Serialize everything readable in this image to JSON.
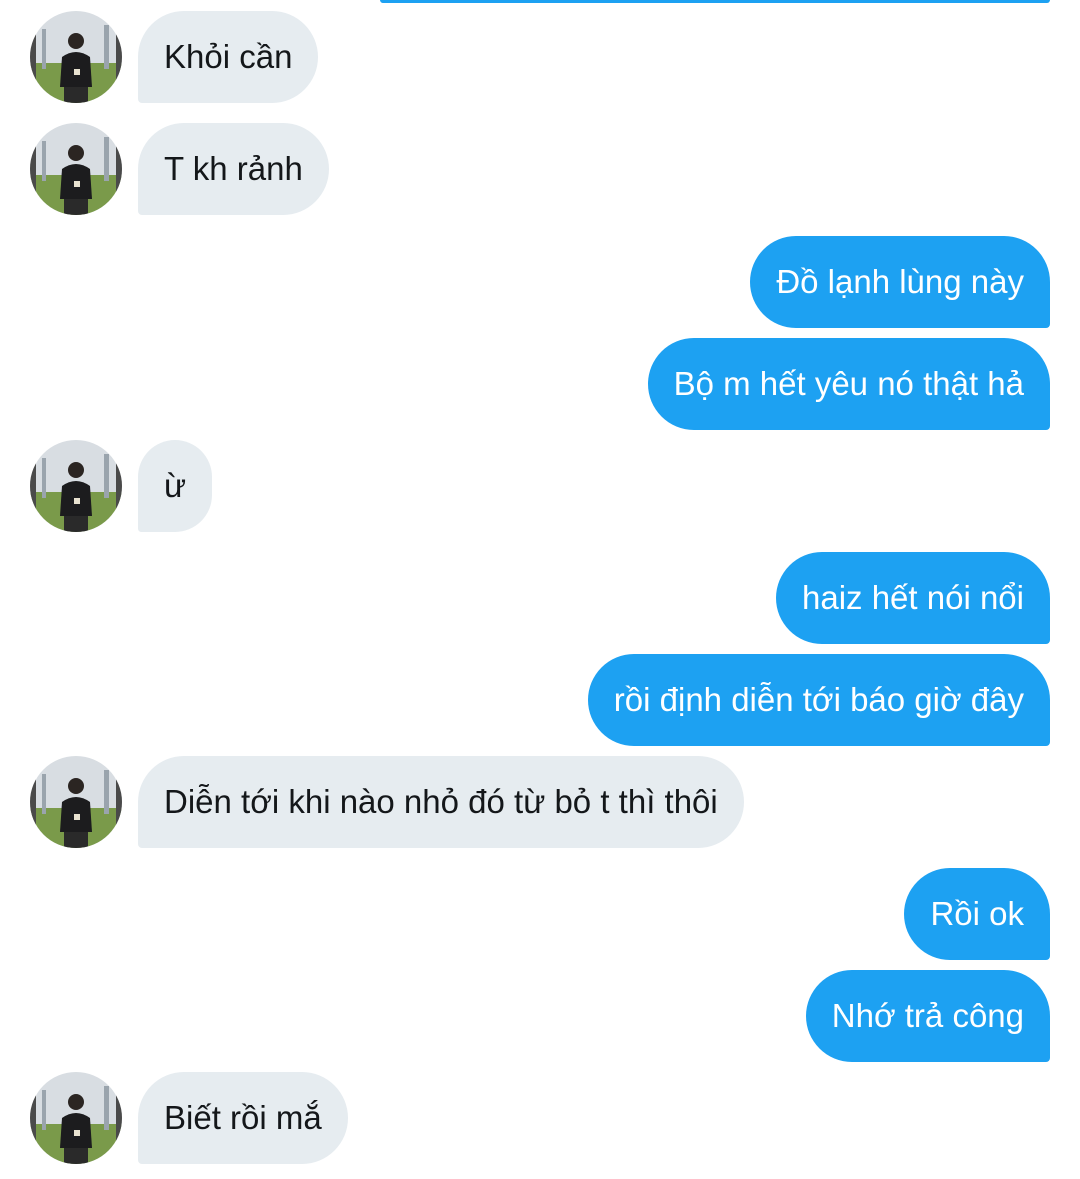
{
  "conversation": {
    "messages": [
      {
        "dir": "in",
        "text": "Khỏi cần"
      },
      {
        "dir": "in",
        "text": "T kh rảnh"
      },
      {
        "dir": "out",
        "text": "Đồ lạnh lùng này"
      },
      {
        "dir": "out",
        "text": "Bộ m hết yêu nó thật hả"
      },
      {
        "dir": "in",
        "text": "ừ"
      },
      {
        "dir": "out",
        "text": "haiz hết nói nổi"
      },
      {
        "dir": "out",
        "text": "rồi định diễn tới báo giờ đây"
      },
      {
        "dir": "in",
        "text": "Diễn tới khi nào nhỏ đó từ bỏ t thì thôi"
      },
      {
        "dir": "out",
        "text": "Rồi ok"
      },
      {
        "dir": "out",
        "text": "Nhớ trả công"
      },
      {
        "dir": "in",
        "text": "Biết rồi mắ"
      }
    ]
  },
  "colors": {
    "incoming_bubble": "#e6ecf0",
    "outgoing_bubble": "#1da1f2",
    "incoming_text": "#14171a",
    "outgoing_text": "#ffffff"
  }
}
